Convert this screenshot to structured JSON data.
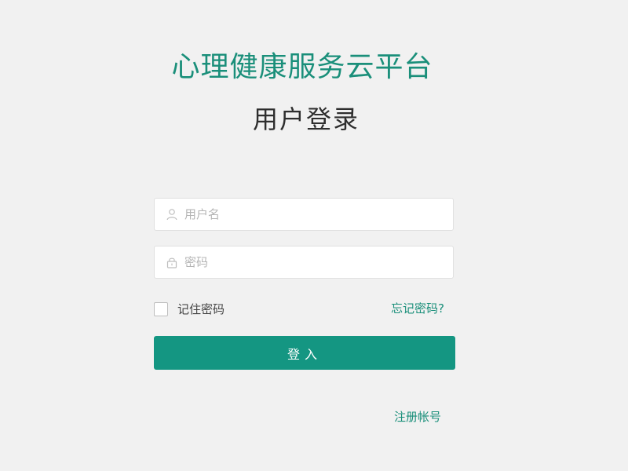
{
  "header": {
    "app_title": "心理健康服务云平台",
    "login_title": "用户登录"
  },
  "form": {
    "username": {
      "placeholder": "用户名",
      "value": "",
      "icon": "user-icon"
    },
    "password": {
      "placeholder": "密码",
      "value": "",
      "icon": "lock-icon"
    },
    "remember": {
      "label": "记住密码",
      "checked": false
    },
    "forgot_label": "忘记密码?",
    "submit_label": "登入",
    "register_label": "注册帐号"
  },
  "colors": {
    "brand": "#1a8f7a",
    "button": "#149682",
    "background": "#f1f1f1",
    "placeholder": "#b5b5b5"
  }
}
